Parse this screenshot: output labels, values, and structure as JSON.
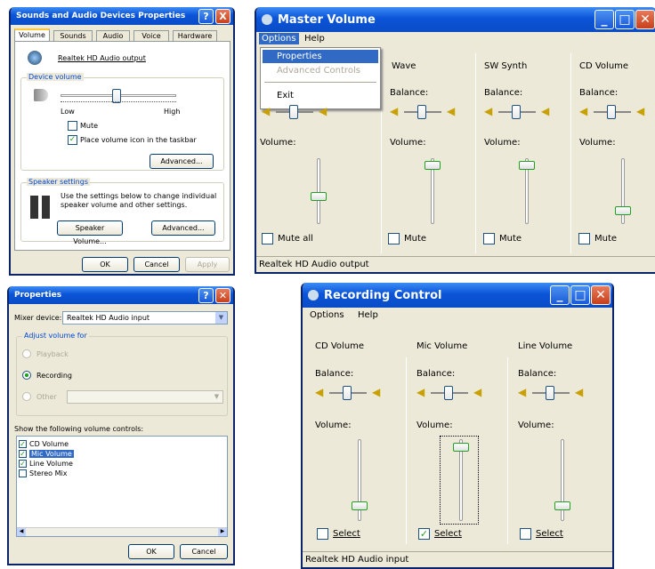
{
  "sap": {
    "title": "Sounds and Audio Devices Properties",
    "tabs": [
      "Volume",
      "Sounds",
      "Audio",
      "Voice",
      "Hardware"
    ],
    "device_name": "Realtek HD Audio output",
    "device_volume_label": "Device volume",
    "low": "Low",
    "high": "High",
    "mute": "Mute",
    "place_icon": "Place volume icon in the taskbar",
    "advanced": "Advanced...",
    "speaker_settings": "Speaker settings",
    "speaker_text": "Use the settings below to change individual speaker volume and other settings.",
    "speaker_volume": "Speaker Volume...",
    "advanced2": "Advanced...",
    "ok": "OK",
    "cancel": "Cancel",
    "apply": "Apply",
    "help": "?",
    "close": "X"
  },
  "mv": {
    "title": "Master Volume",
    "menu": [
      "Options",
      "Help"
    ],
    "dropdown": [
      "Properties",
      "Advanced Controls",
      "Exit"
    ],
    "columns": [
      "Wave",
      "SW Synth",
      "CD Volume"
    ],
    "balance": "Balance:",
    "volume": "Volume:",
    "mute_all": "Mute all",
    "mute": "Mute",
    "status": "Realtek HD Audio output",
    "levels": [
      0.4,
      0.95,
      0.95,
      0.15
    ]
  },
  "props": {
    "title": "Properties",
    "mixer_label": "Mixer device:",
    "mixer_value": "Realtek HD Audio input",
    "adjust_for": "Adjust volume for",
    "playback": "Playback",
    "recording": "Recording",
    "other": "Other",
    "show": "Show the following volume controls:",
    "controls": [
      "CD Volume",
      "Mic Volume",
      "Line Volume",
      "Stereo Mix"
    ],
    "ok": "OK",
    "cancel": "Cancel"
  },
  "rc": {
    "title": "Recording Control",
    "menu": [
      "Options",
      "Help"
    ],
    "columns": [
      "CD Volume",
      "Mic Volume",
      "Line Volume"
    ],
    "balance": "Balance:",
    "volume": "Volume:",
    "select": "Select",
    "status": "Realtek HD Audio input",
    "levels": [
      0.15,
      0.95,
      0.15
    ]
  }
}
